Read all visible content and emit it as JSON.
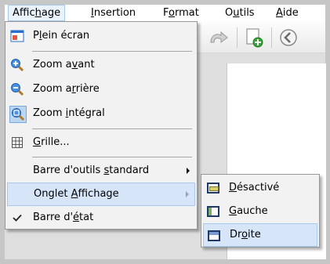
{
  "menubar": {
    "items": [
      {
        "pre": "Affic",
        "key": "h",
        "post": "age"
      },
      {
        "pre": "",
        "key": "I",
        "post": "nsertion"
      },
      {
        "pre": "F",
        "key": "o",
        "post": "rmat"
      },
      {
        "pre": "O",
        "key": "u",
        "post": "tils"
      },
      {
        "pre": "",
        "key": "A",
        "post": "ide"
      }
    ]
  },
  "affichage_menu": {
    "items": [
      {
        "pre": "P",
        "key": "l",
        "post": "ein écran",
        "icon": "fullscreen-icon"
      },
      {
        "pre": "Zoom a",
        "key": "v",
        "post": "ant",
        "icon": "zoom-in-icon"
      },
      {
        "pre": "Zoom a",
        "key": "r",
        "post": "rière",
        "icon": "zoom-out-icon"
      },
      {
        "pre": "Zoom ",
        "key": "i",
        "post": "ntégral",
        "icon": "zoom-fit-icon"
      },
      {
        "pre": "",
        "key": "G",
        "post": "rille...",
        "icon": "grid-icon"
      },
      {
        "pre": "Barre d'outils ",
        "key": "s",
        "post": "tandard"
      },
      {
        "pre": "Onglet ",
        "key": "A",
        "post": "ffichage"
      },
      {
        "pre": "Barre d'",
        "key": "é",
        "post": "tat",
        "icon": "checkmark-icon"
      }
    ]
  },
  "onglet_submenu": {
    "items": [
      {
        "pre": "",
        "key": "D",
        "post": "ésactivé",
        "icon": "tab-disabled-icon"
      },
      {
        "pre": "",
        "key": "G",
        "post": "auche",
        "icon": "tab-left-icon"
      },
      {
        "pre": "Dr",
        "key": "o",
        "post": "ite",
        "icon": "tab-right-icon"
      }
    ]
  },
  "colors": {
    "accent": "#2a6fc9",
    "highlight": "#d6e5f7",
    "highlight_border": "#aac8ec",
    "menu_bg": "#f2f2f2"
  }
}
